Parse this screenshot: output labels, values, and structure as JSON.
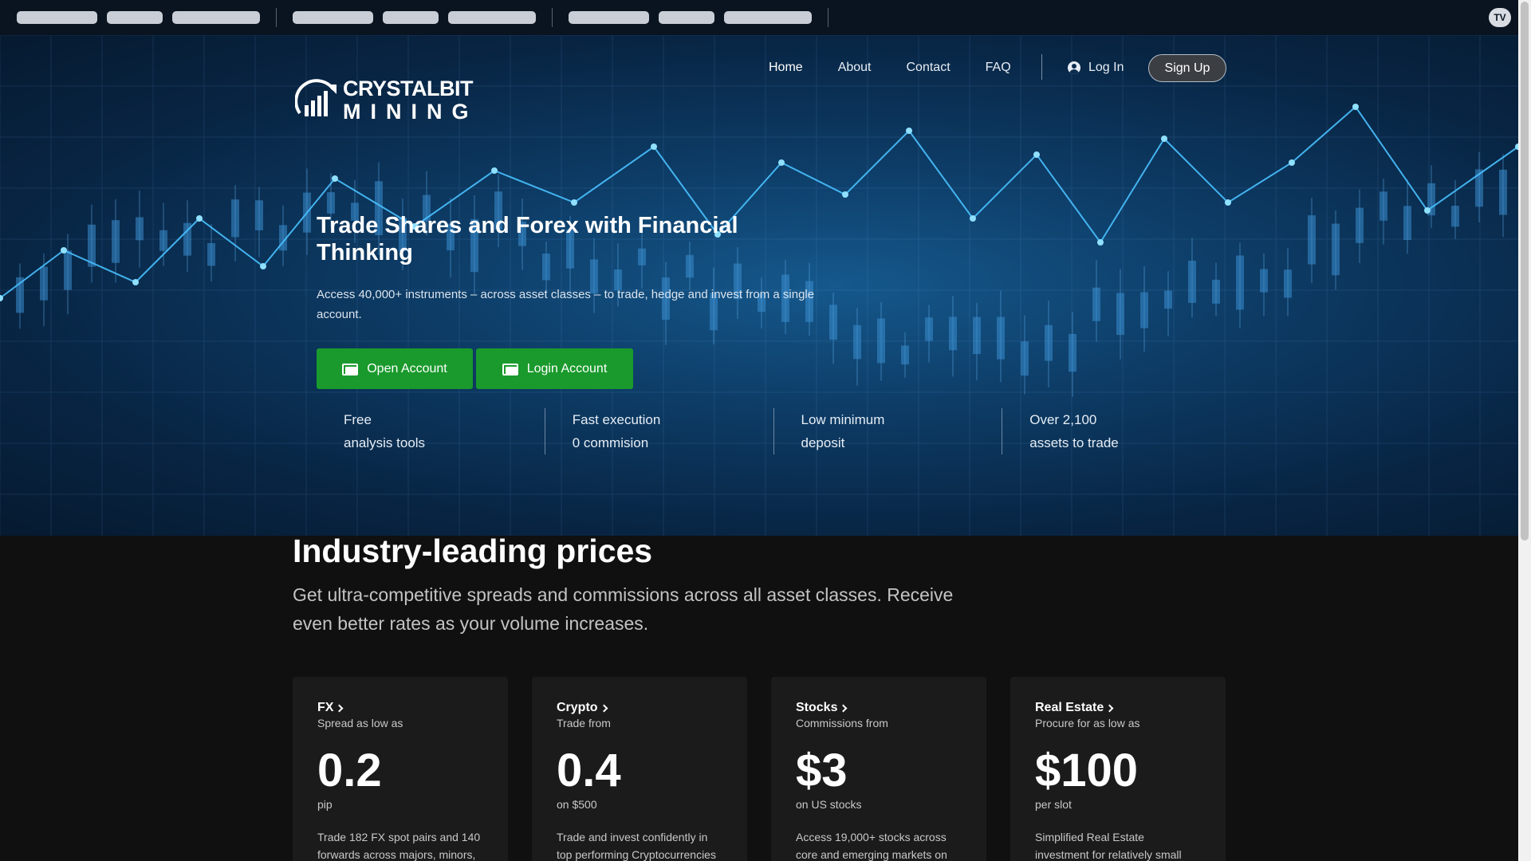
{
  "brand": {
    "line1": "CRYSTALBIT",
    "line2": "MINING"
  },
  "ticker": {
    "logo": "TV"
  },
  "nav": {
    "items": [
      {
        "label": "Home"
      },
      {
        "label": "About"
      },
      {
        "label": "Contact"
      },
      {
        "label": "FAQ"
      }
    ],
    "login": "Log In",
    "signup": "Sign Up"
  },
  "hero": {
    "title": "Trade Shares and Forex with Financial Thinking",
    "subtitle": "Access 40,000+ instruments – across asset classes – to trade, hedge and invest from a single account.",
    "open_button": "Open Account",
    "login_button": "Login Account",
    "features": [
      {
        "line1": "Free",
        "line2": "analysis tools"
      },
      {
        "line1": "Fast execution",
        "line2": "0 commision"
      },
      {
        "line1": "Low minimum",
        "line2": "deposit"
      },
      {
        "line1": "Over 2,100",
        "line2": "assets to trade"
      }
    ]
  },
  "prices": {
    "title": "Industry-leading prices",
    "subtitle": "Get ultra-competitive spreads and commissions across all asset classes. Receive even better rates as your volume increases.",
    "cards": [
      {
        "category": "FX",
        "caption": "Spread as low as",
        "value": "0.2",
        "unit": "pip",
        "desc": "Trade 182 FX spot pairs and 140 forwards across majors, minors,"
      },
      {
        "category": "Crypto",
        "caption": "Trade from",
        "value": "0.4",
        "unit": "on $500",
        "desc": "Trade and invest confidently in top performing Cryptocurrencies"
      },
      {
        "category": "Stocks",
        "caption": "Commissions from",
        "value": "$3",
        "unit": "on US stocks",
        "desc": "Access 19,000+ stocks across core and emerging markets on"
      },
      {
        "category": "Real Estate",
        "caption": "Procure for as low as",
        "value": "$100",
        "unit": "per slot",
        "desc": "Simplified Real Estate investment for relatively small"
      }
    ]
  }
}
